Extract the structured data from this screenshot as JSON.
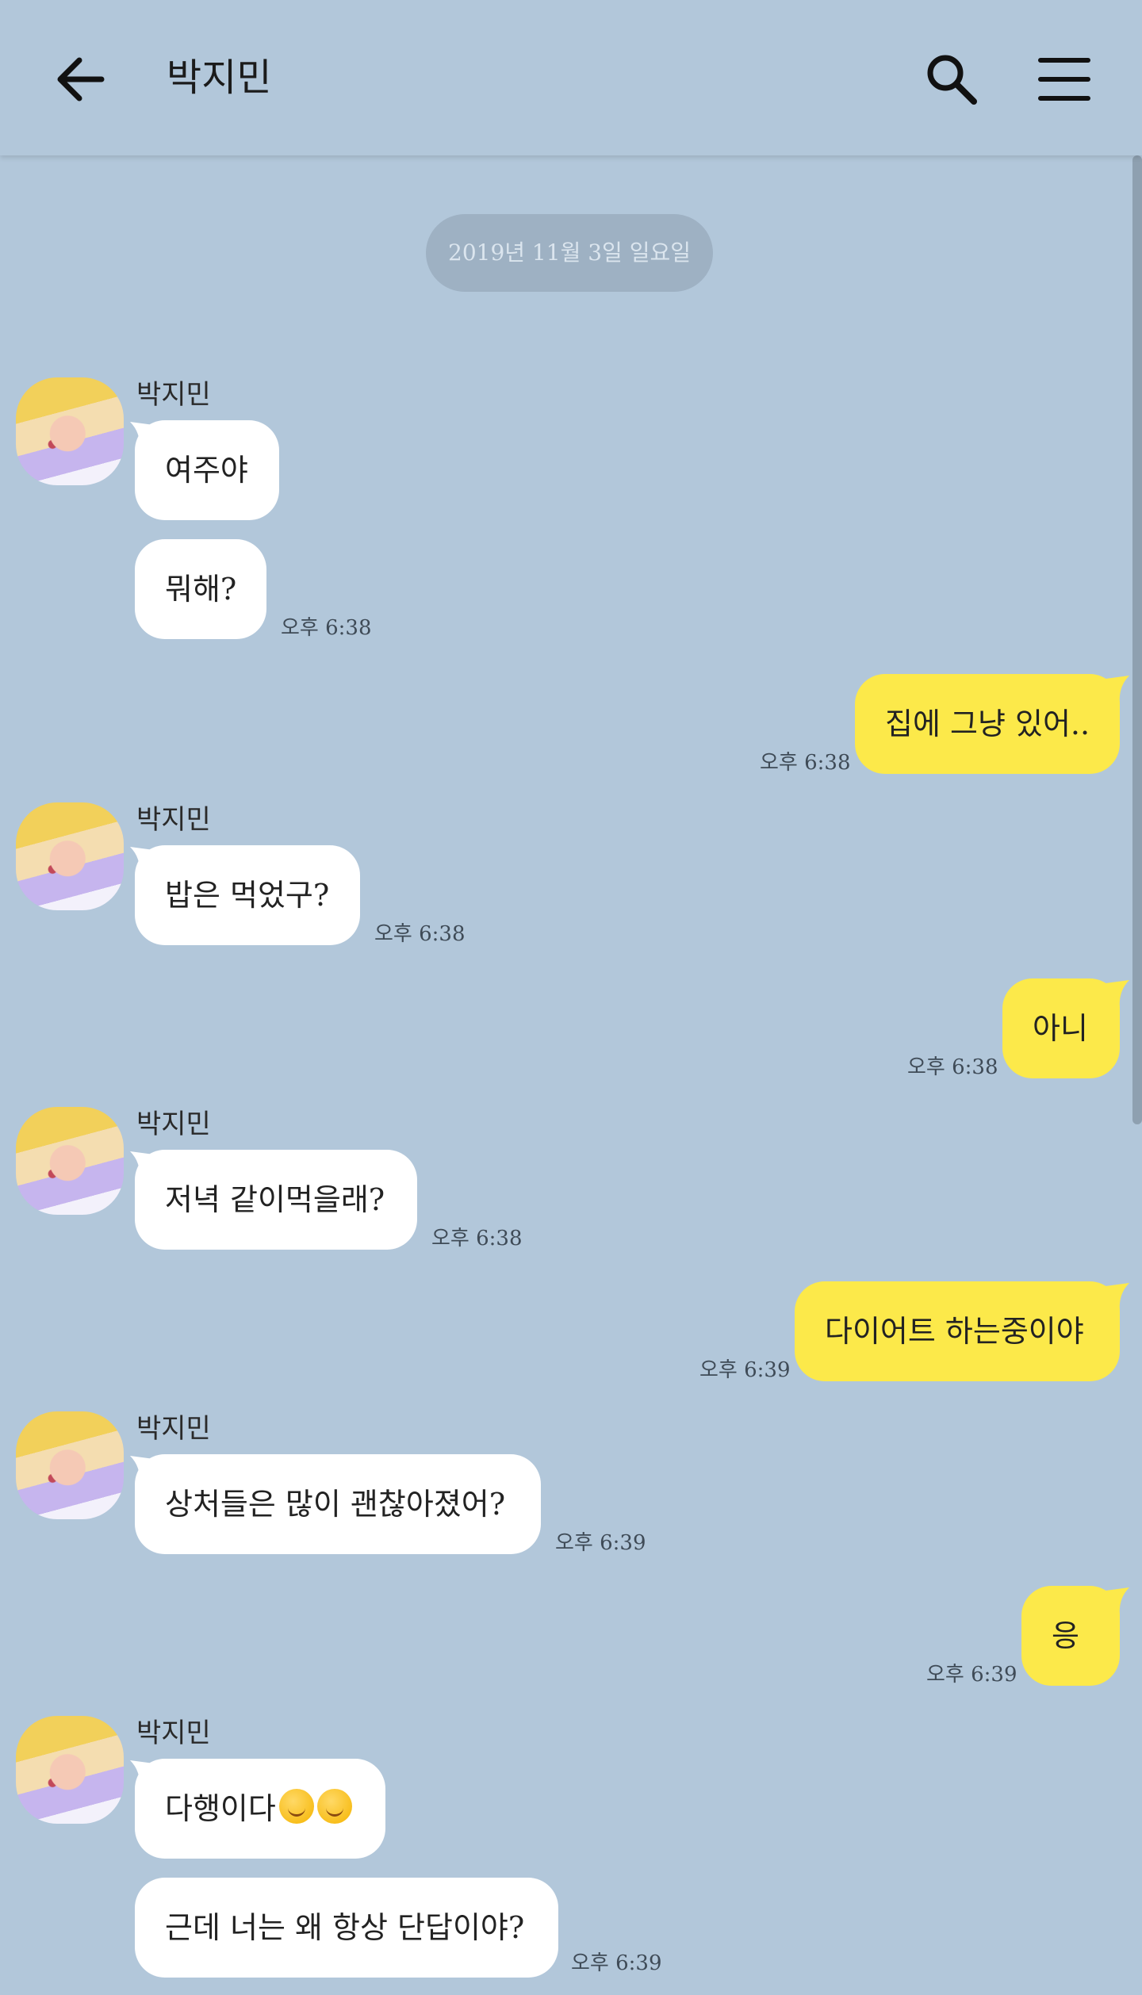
{
  "header": {
    "title": "박지민",
    "back_icon": "arrow-left-icon",
    "search_icon": "search-icon",
    "menu_icon": "hamburger-menu-icon"
  },
  "date_divider": "2019년 11월 3일 일요일",
  "sender_name": "박지민",
  "messages": [
    {
      "side": "in",
      "text": "여주야",
      "time": ""
    },
    {
      "side": "in",
      "text": "뭐해?",
      "time": "오후 6:38"
    },
    {
      "side": "out",
      "text": "집에 그냥 있어..",
      "time": "오후 6:38"
    },
    {
      "side": "in",
      "text": "밥은 먹었구?",
      "time": "오후 6:38"
    },
    {
      "side": "out",
      "text": "아니",
      "time": "오후 6:38"
    },
    {
      "side": "in",
      "text": "저녁 같이먹을래?",
      "time": "오후 6:38"
    },
    {
      "side": "out",
      "text": "다이어트 하는중이야",
      "time": "오후 6:39"
    },
    {
      "side": "in",
      "text": "상처들은 많이 괜찮아졌어?",
      "time": "오후 6:39"
    },
    {
      "side": "out",
      "text": "응",
      "time": "오후 6:39"
    },
    {
      "side": "in",
      "text": "다행이다",
      "emoji": [
        "smiling-face-emoji",
        "smiling-face-emoji"
      ],
      "time": ""
    },
    {
      "side": "in",
      "text": "근데 너는 왜 항상 단답이야?",
      "time": "오후 6:39"
    }
  ],
  "colors": {
    "background": "#b2c7da",
    "outgoing_bubble": "#fce94a",
    "incoming_bubble": "#ffffff",
    "date_pill": "#9eb1c3"
  }
}
